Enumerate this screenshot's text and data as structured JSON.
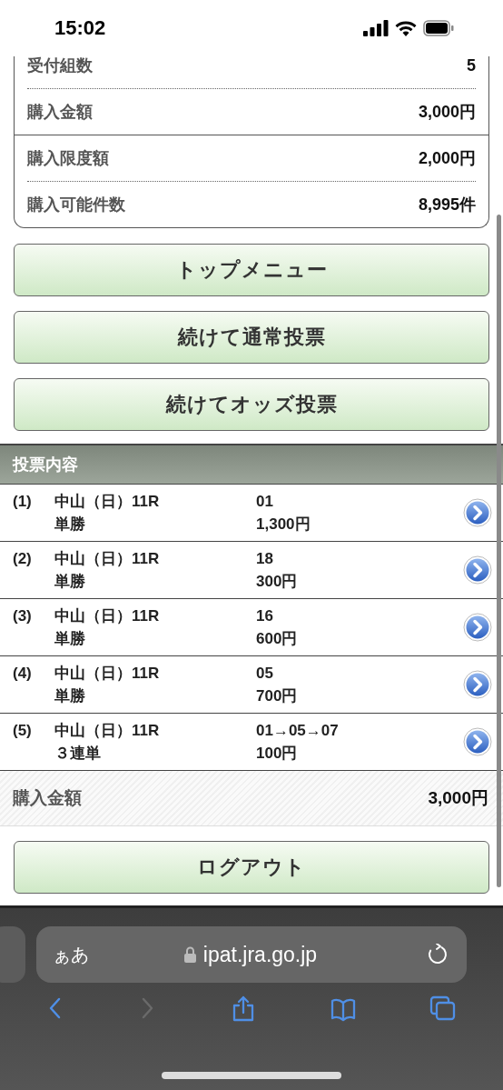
{
  "status_bar": {
    "time": "15:02"
  },
  "summary": {
    "groups": [
      {
        "rows": [
          {
            "label": "受付組数",
            "value": "5"
          },
          {
            "label": "購入金額",
            "value": "3,000円"
          }
        ]
      },
      {
        "rows": [
          {
            "label": "購入限度額",
            "value": "2,000円"
          },
          {
            "label": "購入可能件数",
            "value": "8,995件"
          }
        ]
      }
    ]
  },
  "buttons": [
    "トップメニュー",
    "続けて通常投票",
    "続けてオッズ投票"
  ],
  "bets": {
    "title": "投票内容",
    "items": [
      {
        "index": "(1)",
        "race": "中山（日）11R",
        "type": "単勝",
        "numbers": "01",
        "amount": "1,300円"
      },
      {
        "index": "(2)",
        "race": "中山（日）11R",
        "type": "単勝",
        "numbers": "18",
        "amount": "300円"
      },
      {
        "index": "(3)",
        "race": "中山（日）11R",
        "type": "単勝",
        "numbers": "16",
        "amount": "600円"
      },
      {
        "index": "(4)",
        "race": "中山（日）11R",
        "type": "単勝",
        "numbers": "05",
        "amount": "700円"
      },
      {
        "index": "(5)",
        "race": "中山（日）11R",
        "type": "３連単",
        "numbers": "01→05→07",
        "amount": "100円"
      }
    ],
    "total_label": "購入金額",
    "total": "3,000円"
  },
  "logout": "ログアウト",
  "browser": {
    "text_size": "ぁあ",
    "url": "ipat.jra.go.jp",
    "nav": [
      {
        "kind": "back",
        "disabled": false
      },
      {
        "kind": "forward",
        "disabled": true
      },
      {
        "kind": "share",
        "disabled": false
      },
      {
        "kind": "bookmarks",
        "disabled": false
      },
      {
        "kind": "tabs",
        "disabled": false
      }
    ]
  }
}
